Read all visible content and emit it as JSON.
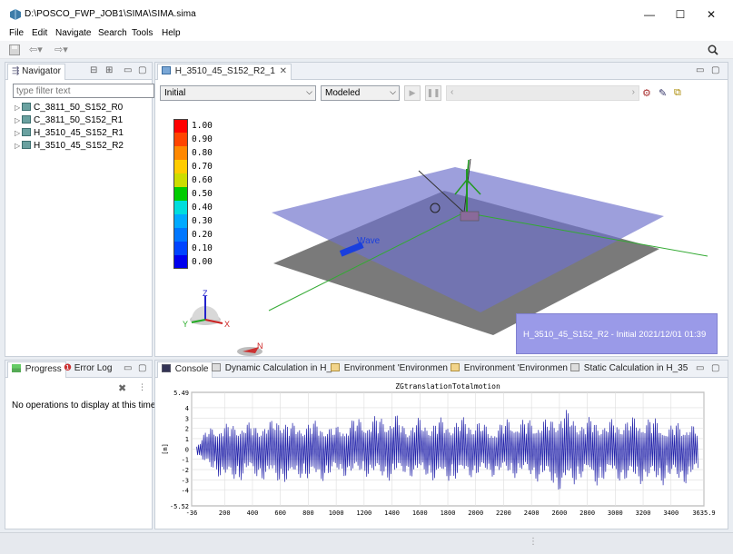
{
  "window": {
    "title": "D:\\POSCO_FWP_JOB1\\SIMA\\SIMA.sima",
    "minimize": "—",
    "maximize": "☐",
    "close": "✕"
  },
  "menu": [
    "File",
    "Edit",
    "Navigate",
    "Search",
    "Tools",
    "Help"
  ],
  "navigator": {
    "tab": "Navigator",
    "filter_placeholder": "type filter text",
    "items": [
      "C_3811_50_S152_R0",
      "C_3811_50_S152_R1",
      "H_3510_45_S152_R1",
      "H_3510_45_S152_R2"
    ]
  },
  "editor": {
    "tab": "H_3510_45_S152_R2_1",
    "condition_select": "Initial",
    "mode_select": "Modeled",
    "scene_label": "Wave",
    "info": "H_3510_45_S152_R2 - Initial   2021/12/01 01:39",
    "axis_x": "X",
    "axis_y": "Y",
    "axis_z": "Z",
    "north": "N",
    "legend": [
      "1.00",
      "0.90",
      "0.80",
      "0.70",
      "0.60",
      "0.50",
      "0.40",
      "0.30",
      "0.20",
      "0.10",
      "0.00"
    ],
    "legend_colors": [
      "#ff0000",
      "#ff4400",
      "#ff8800",
      "#ffcc00",
      "#ccdd00",
      "#00cc00",
      "#00dddd",
      "#00aaff",
      "#0077ff",
      "#0044ff",
      "#0000ee"
    ]
  },
  "progress": {
    "tabs": [
      "Progress",
      "Error Log"
    ],
    "message": "No operations to display at this time."
  },
  "console": {
    "tabs": [
      "Console",
      "Dynamic Calculation in H_",
      "Environment 'Environmen",
      "Environment 'Environmen",
      "Static Calculation in H_35"
    ]
  },
  "chart_data": {
    "type": "line",
    "title": "ZGtranslationTotalmotion",
    "xlabel": "",
    "ylabel": "[m]",
    "xlim": [
      -36,
      3635.9
    ],
    "ylim": [
      -5.52,
      5.49
    ],
    "x_tick_labels": [
      "-36",
      "200",
      "400",
      "600",
      "800",
      "1000",
      "1200",
      "1400",
      "1600",
      "1800",
      "2000",
      "2200",
      "2400",
      "2600",
      "2800",
      "3000",
      "3200",
      "3400",
      "3635.9"
    ],
    "x_ticks": [
      -36,
      200,
      400,
      600,
      800,
      1000,
      1200,
      1400,
      1600,
      1800,
      2000,
      2200,
      2400,
      2600,
      2800,
      3000,
      3200,
      3400,
      3635.9
    ],
    "y_tick_labels": [
      "5.49",
      "4",
      "3",
      "2",
      "1",
      "0",
      "-1",
      "-2",
      "-3",
      "-4",
      "-5.52"
    ],
    "y_ticks": [
      5.49,
      4,
      3,
      2,
      1,
      0,
      -1,
      -2,
      -3,
      -4,
      -5.52
    ],
    "grid": true,
    "series": [
      {
        "color": "#2222aa",
        "x": [
          0,
          75,
          150,
          225,
          300,
          375,
          450,
          525,
          600,
          675,
          750,
          825,
          900,
          975,
          1050,
          1125,
          1200,
          1275,
          1350,
          1425,
          1500,
          1575,
          1650,
          1725,
          1800,
          1875,
          1950,
          2025,
          2100,
          2175,
          2250,
          2325,
          2400,
          2475,
          2550,
          2625,
          2700,
          2775,
          2850,
          2925,
          3000,
          3075,
          3150,
          3225,
          3300,
          3375,
          3450,
          3525,
          3600
        ],
        "upper": [
          0.5,
          2.0,
          2.6,
          2.5,
          2.7,
          2.6,
          2.6,
          2.7,
          3.6,
          2.5,
          2.7,
          2.8,
          2.8,
          2.1,
          2.6,
          3.1,
          3.2,
          3.3,
          3.4,
          3.5,
          2.4,
          3.2,
          2.6,
          3.2,
          2.8,
          3.1,
          3.2,
          2.9,
          2.1,
          2.6,
          3.3,
          2.9,
          3.2,
          2.8,
          3.3,
          4.1,
          3.4,
          2.8,
          3.4,
          2.5,
          3.2,
          3.0,
          3.3,
          3.2,
          3.1,
          2.2,
          2.8,
          2.6,
          2.0
        ],
        "lower": [
          -0.5,
          -2.0,
          -2.6,
          -3.7,
          -3.2,
          -2.8,
          -3.0,
          -3.5,
          -3.3,
          -3.8,
          -2.8,
          -3.6,
          -3.2,
          -2.8,
          -2.7,
          -2.8,
          -2.6,
          -3.0,
          -3.1,
          -3.2,
          -2.5,
          -3.2,
          -2.7,
          -3.7,
          -3.2,
          -3.3,
          -2.8,
          -2.9,
          -2.8,
          -2.6,
          -2.9,
          -2.7,
          -3.0,
          -3.4,
          -3.8,
          -4.4,
          -3.9,
          -2.6,
          -3.9,
          -3.2,
          -3.0,
          -3.5,
          -3.6,
          -3.3,
          -3.8,
          -3.3,
          -3.5,
          -3.4,
          -3.0
        ]
      }
    ]
  }
}
